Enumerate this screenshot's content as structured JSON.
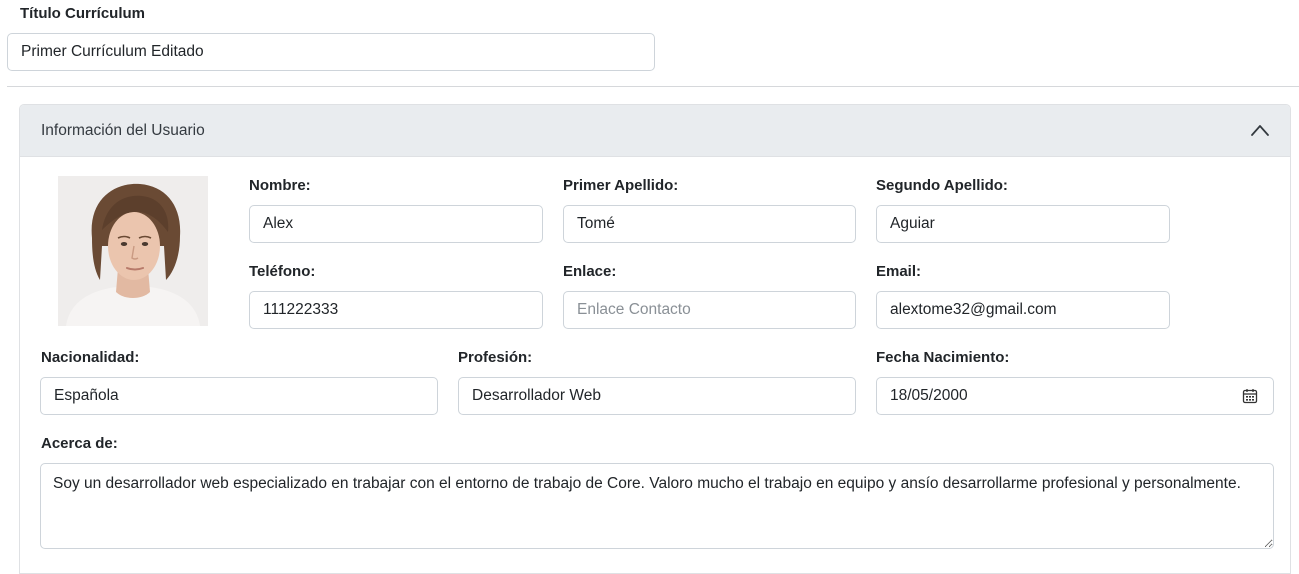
{
  "curriculum": {
    "title_label": "Título Currículum",
    "title_value": "Primer Currículum Editado"
  },
  "section": {
    "title": "Información del Usuario",
    "collapse_icon": "chevron-up-icon"
  },
  "user": {
    "photo_alt": "avatar",
    "nombre_label": "Nombre:",
    "nombre_value": "Alex",
    "primer_apellido_label": "Primer Apellido:",
    "primer_apellido_value": "Tomé",
    "segundo_apellido_label": "Segundo Apellido:",
    "segundo_apellido_value": "Aguiar",
    "telefono_label": "Teléfono:",
    "telefono_value": "111222333",
    "enlace_label": "Enlace:",
    "enlace_placeholder": "Enlace Contacto",
    "enlace_value": "",
    "email_label": "Email:",
    "email_value": "alextome32@gmail.com",
    "nacionalidad_label": "Nacionalidad:",
    "nacionalidad_value": "Española",
    "profesion_label": "Profesión:",
    "profesion_value": "Desarrollador Web",
    "fecha_label": "Fecha Nacimiento:",
    "fecha_value": "18/05/2000",
    "fecha_icon": "calendar-icon",
    "acerca_label": "Acerca de:",
    "acerca_value": "Soy un desarrollador web especializado en trabajar con el entorno de trabajo de Core. Valoro mucho el trabajo en equipo y ansío desarrollarme profesional y personalmente."
  }
}
